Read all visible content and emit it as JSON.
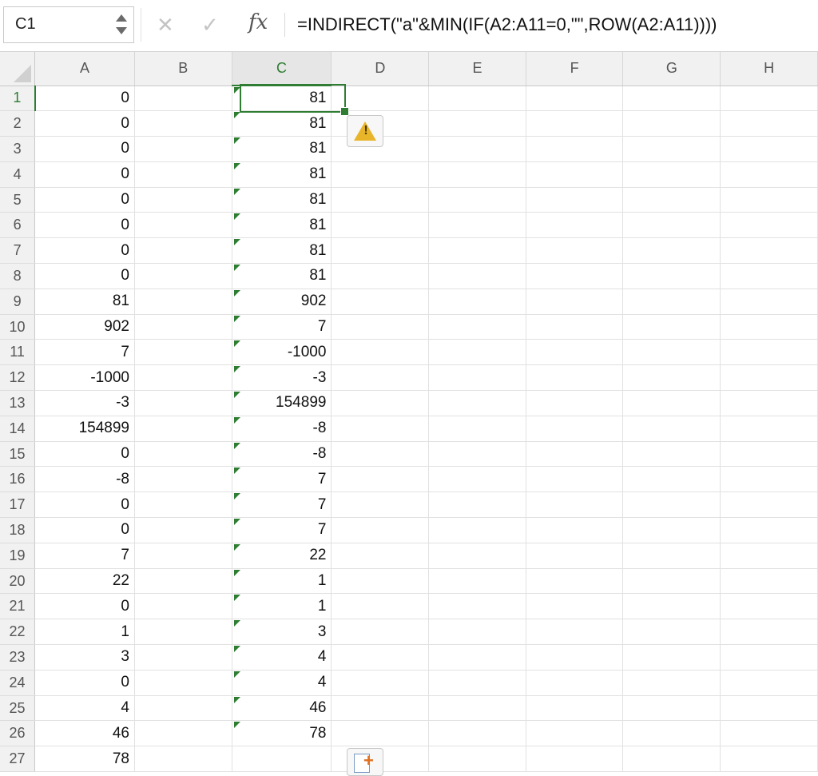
{
  "formula_bar": {
    "name_box": "C1",
    "cancel_icon": "✕",
    "confirm_icon": "✓",
    "fx_label": "fx",
    "formula": "=INDIRECT(\"a\"&MIN(IF(A2:A11=0,\"\",ROW(A2:A11))))"
  },
  "columns": [
    "A",
    "B",
    "C",
    "D",
    "E",
    "F",
    "G",
    "H"
  ],
  "active_cell": "C1",
  "rows": [
    {
      "n": "1",
      "a": "0",
      "c": "81"
    },
    {
      "n": "2",
      "a": "0",
      "c": "81"
    },
    {
      "n": "3",
      "a": "0",
      "c": "81"
    },
    {
      "n": "4",
      "a": "0",
      "c": "81"
    },
    {
      "n": "5",
      "a": "0",
      "c": "81"
    },
    {
      "n": "6",
      "a": "0",
      "c": "81"
    },
    {
      "n": "7",
      "a": "0",
      "c": "81"
    },
    {
      "n": "8",
      "a": "0",
      "c": "81"
    },
    {
      "n": "9",
      "a": "81",
      "c": "902"
    },
    {
      "n": "10",
      "a": "902",
      "c": "7"
    },
    {
      "n": "11",
      "a": "7",
      "c": "-1000"
    },
    {
      "n": "12",
      "a": "-1000",
      "c": "-3"
    },
    {
      "n": "13",
      "a": "-3",
      "c": "154899"
    },
    {
      "n": "14",
      "a": "154899",
      "c": "-8"
    },
    {
      "n": "15",
      "a": "0",
      "c": "-8"
    },
    {
      "n": "16",
      "a": "-8",
      "c": "7"
    },
    {
      "n": "17",
      "a": "0",
      "c": "7"
    },
    {
      "n": "18",
      "a": "0",
      "c": "7"
    },
    {
      "n": "19",
      "a": "7",
      "c": "22"
    },
    {
      "n": "20",
      "a": "22",
      "c": "1"
    },
    {
      "n": "21",
      "a": "0",
      "c": "1"
    },
    {
      "n": "22",
      "a": "1",
      "c": "3"
    },
    {
      "n": "23",
      "a": "3",
      "c": "4"
    },
    {
      "n": "24",
      "a": "0",
      "c": "4"
    },
    {
      "n": "25",
      "a": "4",
      "c": "46"
    },
    {
      "n": "26",
      "a": "46",
      "c": "78"
    },
    {
      "n": "27",
      "a": "78",
      "c": ""
    }
  ],
  "colors": {
    "accent": "#2e7d32",
    "warning": "#e8b42a"
  },
  "icons": {
    "warning": "warning-icon",
    "paste_options": "paste-options-icon"
  }
}
